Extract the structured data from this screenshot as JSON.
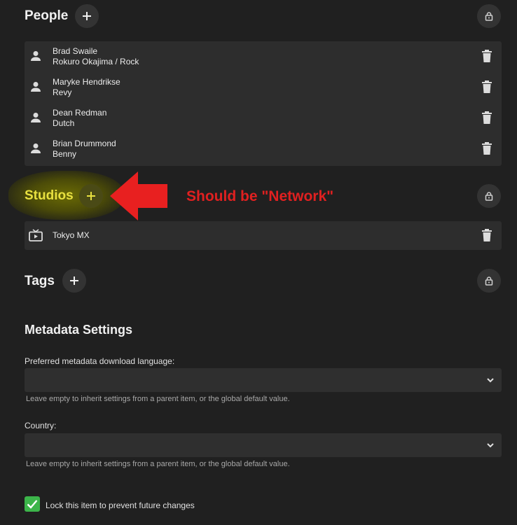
{
  "people": {
    "title": "People",
    "items": [
      {
        "name": "Brad Swaile",
        "role": "Rokuro Okajima / Rock"
      },
      {
        "name": "Maryke Hendrikse",
        "role": "Revy"
      },
      {
        "name": "Dean Redman",
        "role": "Dutch"
      },
      {
        "name": "Brian Drummond",
        "role": "Benny"
      }
    ]
  },
  "studios": {
    "title": "Studios",
    "items": [
      {
        "name": "Tokyo MX"
      }
    ]
  },
  "annotation": {
    "text": "Should be \"Network\"",
    "color": "#e02020"
  },
  "tags": {
    "title": "Tags"
  },
  "metadata": {
    "title": "Metadata Settings",
    "language_label": "Preferred metadata download language:",
    "language_value": "",
    "language_help": "Leave empty to inherit settings from a parent item, or the global default value.",
    "country_label": "Country:",
    "country_value": "",
    "country_help": "Leave empty to inherit settings from a parent item, or the global default value."
  },
  "lock": {
    "label": "Lock this item to prevent future changes",
    "checked": true
  },
  "colors": {
    "background": "#202020",
    "accent_green": "#3cb54a",
    "highlight_yellow": "#e8e040"
  },
  "icons": [
    "plus-icon",
    "lock-icon",
    "person-icon",
    "trash-icon",
    "tv-icon",
    "chevron-down-icon",
    "check-icon",
    "arrow-left-icon"
  ]
}
